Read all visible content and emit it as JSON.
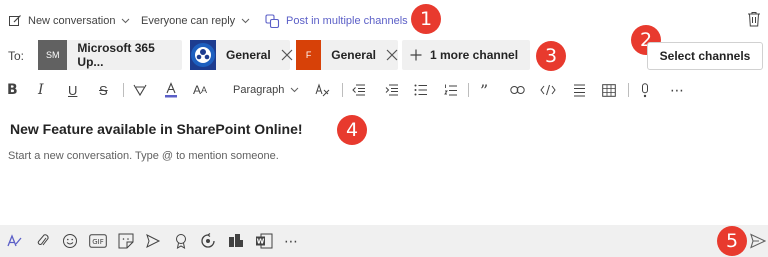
{
  "topbar": {
    "new_conversation_label": "New conversation",
    "reply_setting_label": "Everyone can reply",
    "post_multiple_label": "Post in multiple channels"
  },
  "recipients": {
    "to_label": "To:",
    "chips": [
      {
        "name": "Microsoft 365 Up...",
        "avatar_text": "SM",
        "avatar_color": "#616161"
      },
      {
        "name": "General",
        "avatar_text": "",
        "avatar_color": "#1d3c8f"
      },
      {
        "name": "General",
        "avatar_text": "F",
        "avatar_color": "#d74108"
      }
    ],
    "more_label": "1 more channel",
    "select_button_label": "Select channels"
  },
  "format_toolbar": {
    "paragraph_label": "Paragraph"
  },
  "compose": {
    "subject": "New Feature available in SharePoint Online!",
    "body_placeholder": "Start a new conversation. Type @ to mention someone."
  },
  "badges": [
    "1",
    "2",
    "3",
    "4",
    "5"
  ],
  "colors": {
    "accent": "#5b5fc7",
    "badge": "#e83a2e",
    "bottom_bar": "#f0f0f0"
  }
}
